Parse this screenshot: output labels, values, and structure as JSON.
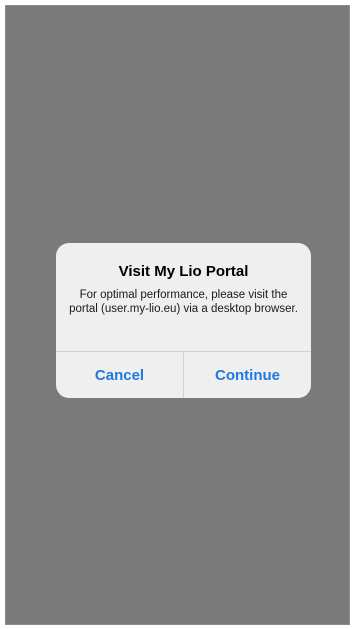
{
  "alert": {
    "title": "Visit My Lio Portal",
    "message": "For optimal performance, please visit the portal (user.my-lio.eu) via a desktop browser.",
    "buttons": {
      "cancel_label": "Cancel",
      "continue_label": "Continue"
    }
  },
  "colors": {
    "overlay": "#7a7a7a",
    "dialog_background": "#efefef",
    "button_text": "#1f7ae0"
  }
}
